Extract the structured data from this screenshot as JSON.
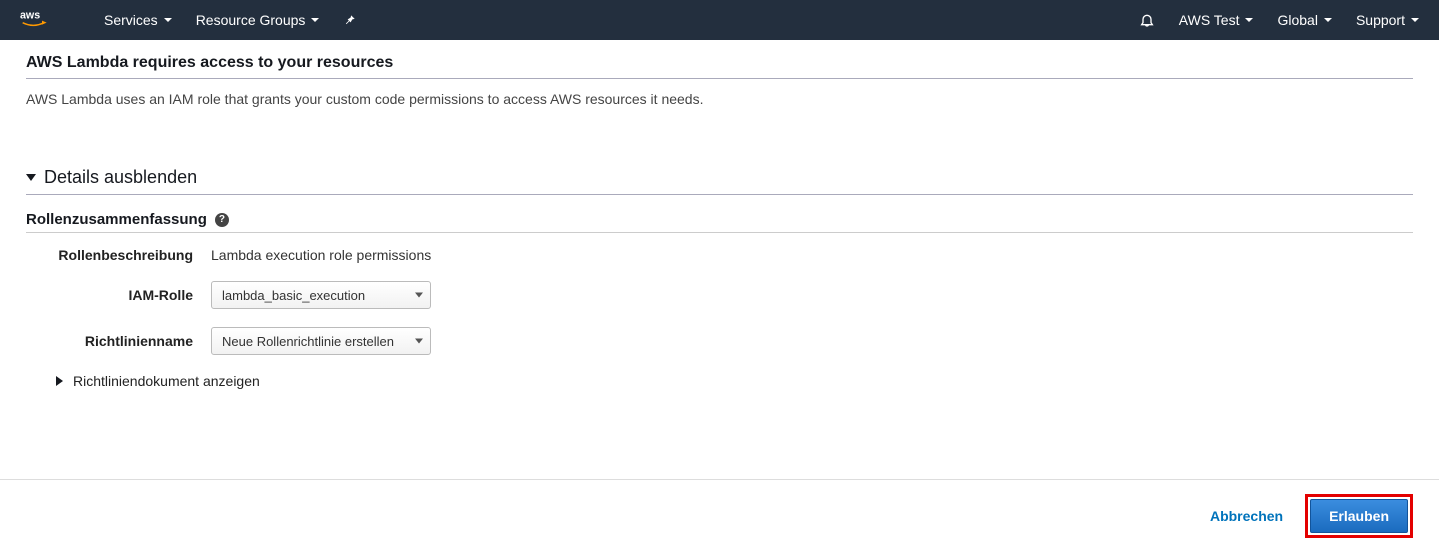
{
  "nav": {
    "services": "Services",
    "resource_groups": "Resource Groups",
    "account": "AWS Test",
    "region": "Global",
    "support": "Support"
  },
  "section": {
    "title": "AWS Lambda requires access to your resources",
    "description": "AWS Lambda uses an IAM role that grants your custom code permissions to access AWS resources it needs."
  },
  "details": {
    "toggle": "Details ausblenden",
    "role_summary": "Rollenzusammenfassung",
    "labels": {
      "description": "Rollenbeschreibung",
      "iam_role": "IAM-Rolle",
      "policy_name": "Richtlinienname"
    },
    "values": {
      "description": "Lambda execution role permissions",
      "iam_role": "lambda_basic_execution",
      "policy_name": "Neue Rollenrichtlinie erstellen"
    },
    "policy_doc": "Richtliniendokument anzeigen"
  },
  "footer": {
    "cancel": "Abbrechen",
    "allow": "Erlauben"
  }
}
